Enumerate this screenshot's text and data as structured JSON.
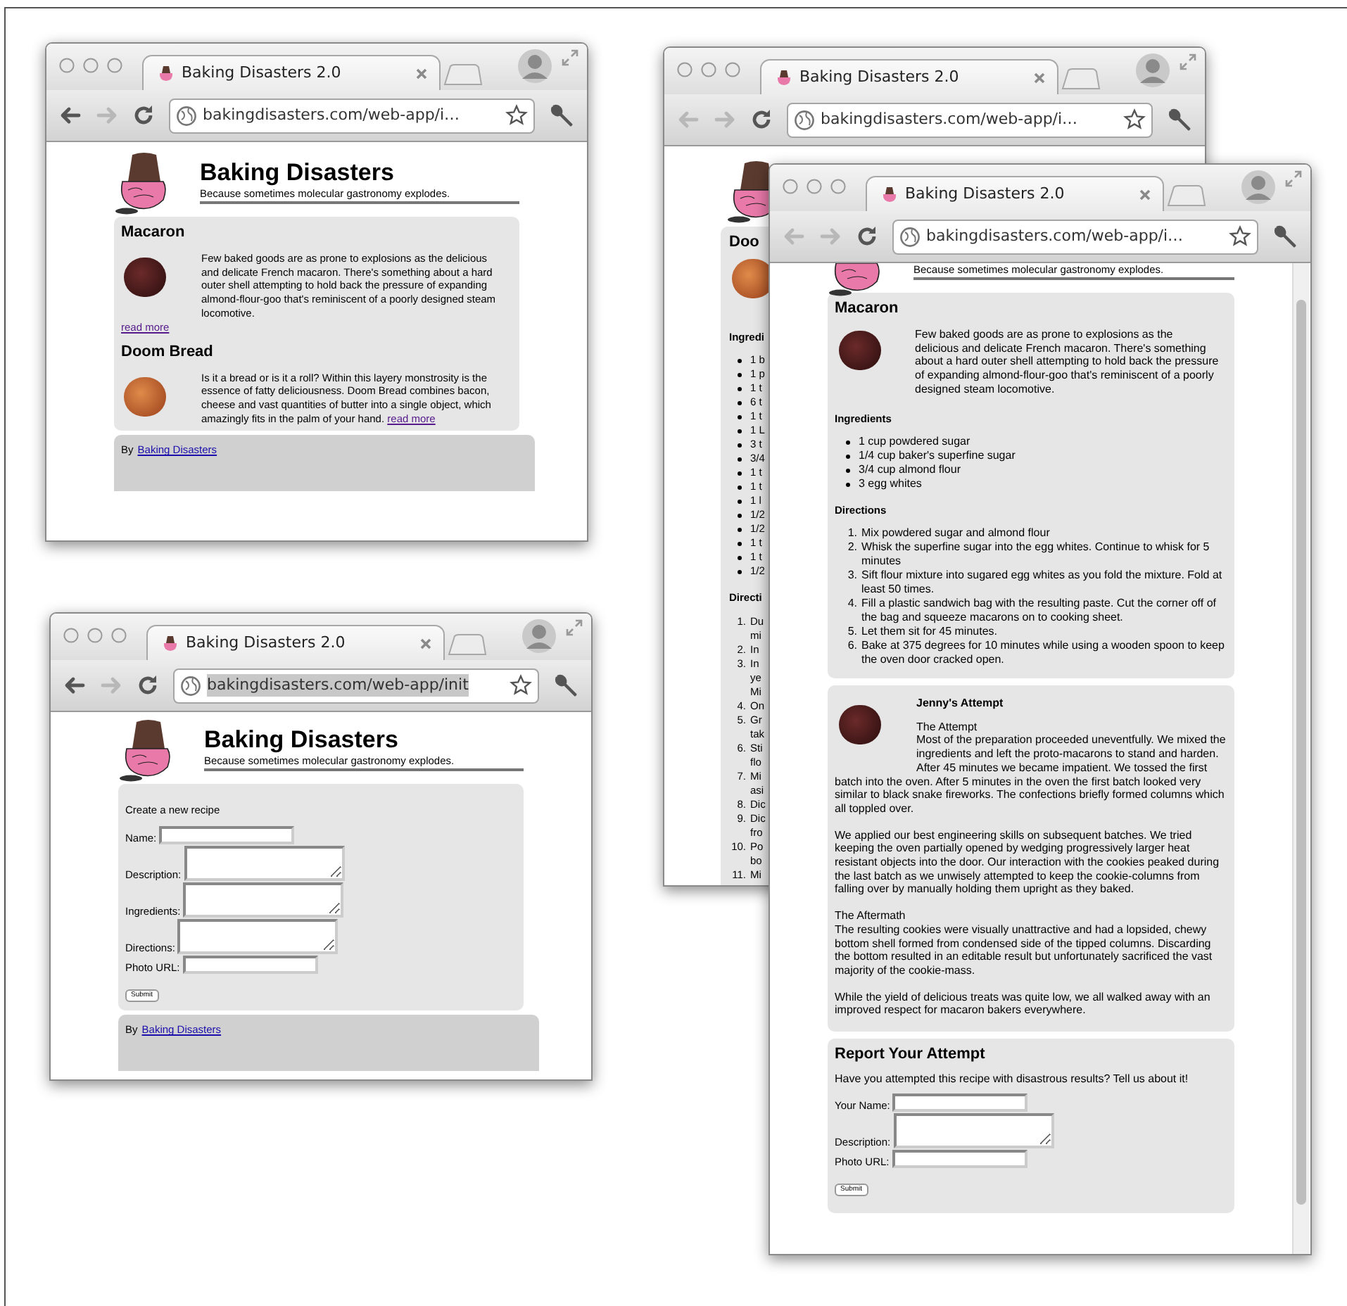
{
  "windows": [
    {
      "kind": "recipe_list",
      "tab_title": "Baking Disasters 2.0",
      "url": "bakingdisasters.com/web-app/i…",
      "url_selected": false,
      "back_enabled": true,
      "forward_enabled": false,
      "page": {
        "site": {
          "title": "Baking Disasters",
          "tagline": "Because sometimes molecular gastronomy explodes."
        },
        "recipes": [
          {
            "name": "Macaron",
            "photo": {
              "kind": "macaron"
            },
            "description": "Few baked goods are as prone to explosions as the delicious and delicate French macaron. There's something about a hard outer shell attempting to hold back the pressure of expanding almond-flour-goo that's reminiscent of a poorly designed steam locomotive.",
            "read_more": "read more",
            "read_more_inline": false
          },
          {
            "name": "Doom Bread",
            "photo": {
              "kind": "bread"
            },
            "description": "Is it a bread or is it a roll? Within this layery monstrosity is the essence of fatty deliciousness. Doom Bread combines bacon, cheese and vast quantities of butter into a single object, which amazingly fits in the palm of your hand.",
            "read_more": "read more",
            "read_more_inline": true
          }
        ],
        "footer": {
          "by": "By",
          "link": "Baking Disasters"
        }
      }
    },
    {
      "kind": "new_recipe_form",
      "tab_title": "Baking Disasters 2.0",
      "url": "bakingdisasters.com/web-app/init",
      "url_selected": true,
      "back_enabled": true,
      "forward_enabled": false,
      "page": {
        "site": {
          "title": "Baking Disasters",
          "tagline": "Because sometimes molecular gastronomy explodes."
        },
        "form": {
          "intro": "Create a new recipe",
          "fields": [
            {
              "label": "Name:",
              "kind": "text"
            },
            {
              "label": "Description:",
              "kind": "textarea"
            },
            {
              "label": "Ingredients:",
              "kind": "textarea"
            },
            {
              "label": "Directions:",
              "kind": "textarea"
            },
            {
              "label": "Photo URL:",
              "kind": "text"
            }
          ],
          "submit": "Submit"
        },
        "footer": {
          "by": "By",
          "link": "Baking Disasters"
        }
      }
    },
    {
      "kind": "recipe_partial",
      "tab_title": "Baking Disasters 2.0",
      "url": "bakingdisasters.com/web-app/i…",
      "url_selected": false,
      "back_enabled": false,
      "forward_enabled": false,
      "page": {
        "name": "Doo",
        "photo": {
          "kind": "bread"
        },
        "ingredients_label": "Ingredi",
        "ingredients": [
          "1 b",
          "1 p",
          "1 t",
          "6 t",
          "1 t",
          "1 L",
          "3 t",
          "3/4",
          "1 t",
          "1 t",
          "1 l",
          "1/2",
          "1/2",
          "1 t",
          "1 t",
          "1/2"
        ],
        "directions_label": "Directi",
        "directions": [
          {
            "number": "1.",
            "text": "Du\nmi"
          },
          {
            "number": "2.",
            "text": "In"
          },
          {
            "number": "3.",
            "text": "In\nye\nMi"
          },
          {
            "number": "4.",
            "text": "On"
          },
          {
            "number": "5.",
            "text": "Gr\ntak"
          },
          {
            "number": "6.",
            "text": "Sti\nflo"
          },
          {
            "number": "7.",
            "text": "Mi\nasi"
          },
          {
            "number": "8.",
            "text": "Dic"
          },
          {
            "number": "9.",
            "text": "Dic\nfro"
          },
          {
            "number": "10.",
            "text": "Po\nbo"
          },
          {
            "number": "11.",
            "text": "Mi"
          }
        ]
      }
    },
    {
      "kind": "recipe_detail",
      "tab_title": "Baking Disasters 2.0",
      "url": "bakingdisasters.com/web-app/i…",
      "url_selected": false,
      "back_enabled": false,
      "forward_enabled": false,
      "page": {
        "tagline": "Because sometimes molecular gastronomy explodes.",
        "recipe": {
          "name": "Macaron",
          "photo": {
            "kind": "macaron"
          },
          "description": "Few baked goods are as prone to explosions as the delicious and delicate French macaron. There's something about a hard outer shell attempting to hold back the pressure of expanding almond-flour-goo that's reminiscent of a poorly designed steam locomotive.",
          "ingredients_label": "Ingredients",
          "ingredients": [
            "1 cup powdered sugar",
            "1/4 cup baker's superfine sugar",
            "3/4 cup almond flour",
            "3 egg whites"
          ],
          "directions_label": "Directions",
          "directions": [
            {
              "number": "1.",
              "text": "Mix powdered sugar and almond flour"
            },
            {
              "number": "2.",
              "text": "Whisk the superfine sugar into the egg whites. Continue to whisk for 5 minutes"
            },
            {
              "number": "3.",
              "text": "Sift flour mixture into sugared egg whites as you fold the mixture. Fold at least 50 times."
            },
            {
              "number": "4.",
              "text": "Fill a plastic sandwich bag with the resulting paste. Cut the corner off of the bag and squeeze macarons on to cooking sheet."
            },
            {
              "number": "5.",
              "text": "Let them sit for 45 minutes."
            },
            {
              "number": "6.",
              "text": "Bake at 375 degrees for 10 minutes while using a wooden spoon to keep the oven door cracked open."
            }
          ]
        },
        "attempt": {
          "photo": {
            "kind": "macaron"
          },
          "author": "Jenny's Attempt",
          "sections": [
            {
              "heading": "The Attempt",
              "text": "Most of the preparation proceeded uneventfully. We mixed the ingredients and left the proto-macarons to stand and harden. After 45 minutes we became impatient. We tossed the first batch into the oven. After 5 minutes in the oven the first batch looked very similar to black snake fireworks. The confections briefly formed columns which all toppled over."
            },
            {
              "text": "We applied our best engineering skills on subsequent batches. We tried keeping the oven partially opened by wedging progressively larger heat resistant objects into the door. Our interaction with the cookies peaked during the last batch as we unwisely attempted to keep the cookie-columns from falling over by manually holding them upright as they baked."
            },
            {
              "heading": "The Aftermath",
              "text": "The resulting cookies were visually unattractive and had a lopsided, chewy bottom shell formed from condensed side of the tipped columns. Discarding the bottom resulted in an editable result but unfortunately sacrificed the vast majority of the cookie-mass."
            },
            {
              "text": "While the yield of delicious treats was quite low, we all walked away with an improved respect for macaron bakers everywhere."
            }
          ]
        },
        "report": {
          "heading": "Report Your Attempt",
          "prompt": "Have you attempted this recipe with disastrous results? Tell us about it!",
          "fields": [
            {
              "label": "Your Name:",
              "kind": "text"
            },
            {
              "label": "Description:",
              "kind": "textarea"
            },
            {
              "label": "Photo URL:",
              "kind": "text"
            }
          ],
          "submit": "Submit"
        }
      }
    }
  ]
}
